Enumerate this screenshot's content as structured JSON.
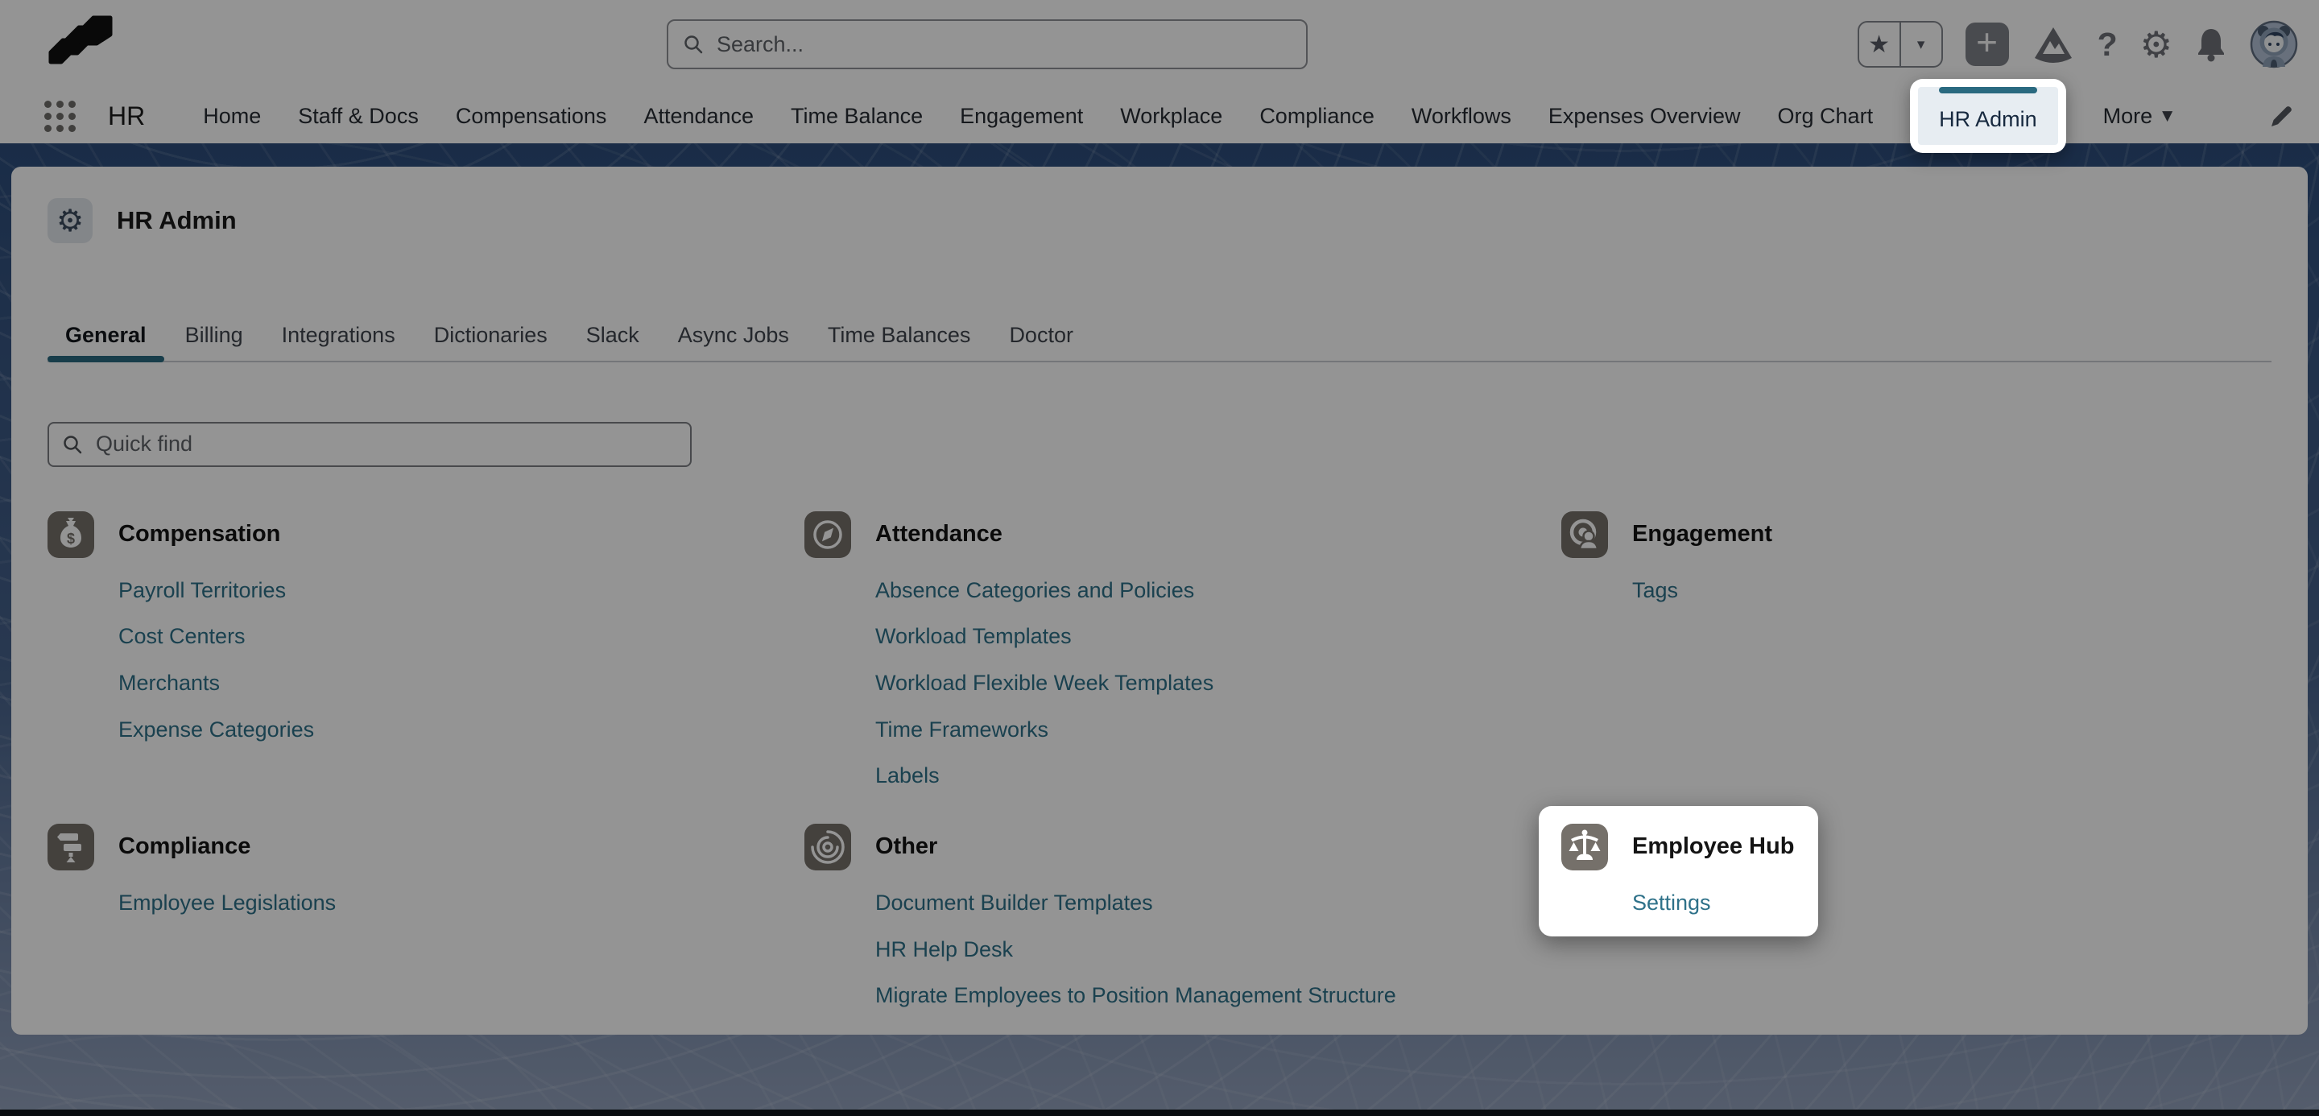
{
  "header": {
    "search": {
      "placeholder": "Search..."
    },
    "actions": {
      "favorites_star_glyph": "★",
      "favorites_caret_glyph": "▾",
      "add_glyph": "+",
      "help_glyph": "?",
      "setup_glyph": "⚙"
    }
  },
  "nav": {
    "app_name": "HR",
    "items": [
      "Home",
      "Staff & Docs",
      "Compensations",
      "Attendance",
      "Time Balance",
      "Engagement",
      "Workplace",
      "Compliance",
      "Workflows",
      "Expenses Overview",
      "Org Chart",
      "HR Admin"
    ],
    "more_label": "More",
    "more_caret_glyph": "▼"
  },
  "page": {
    "title": "HR Admin",
    "tabs": [
      "General",
      "Billing",
      "Integrations",
      "Dictionaries",
      "Slack",
      "Async Jobs",
      "Time Balances",
      "Doctor"
    ],
    "active_tab": "General",
    "quick_find_placeholder": "Quick find"
  },
  "sections": [
    {
      "title": "Compensation",
      "icon": "money-bag-icon",
      "links": [
        "Payroll Territories",
        "Cost Centers",
        "Merchants",
        "Expense Categories"
      ]
    },
    {
      "title": "Attendance",
      "icon": "compass-icon",
      "links": [
        "Absence Categories and Policies",
        "Workload Templates",
        "Workload Flexible Week Templates",
        "Time Frameworks",
        "Labels"
      ]
    },
    {
      "title": "Engagement",
      "icon": "person-target-icon",
      "links": [
        "Tags"
      ]
    },
    {
      "title": "Compliance",
      "icon": "signpost-icon",
      "links": [
        "Employee Legislations"
      ]
    },
    {
      "title": "Other",
      "icon": "spiral-disc-icon",
      "links": [
        "Document Builder Templates",
        "HR Help Desk",
        "Migrate Employees to Position Management Structure"
      ]
    },
    {
      "title": "Employee Hub",
      "icon": "balance-scale-icon",
      "highlighted": true,
      "links": [
        "Settings"
      ]
    }
  ],
  "spotlight": {
    "highlighted_nav_tab": "HR Admin",
    "highlighted_section": "Employee Hub"
  },
  "colors": {
    "accent_teal": "#2a6a80",
    "link_teal": "#2e7189",
    "section_tile": "#75706a",
    "band_top": "#2d4d7b",
    "band_bottom": "#93a1bb"
  }
}
